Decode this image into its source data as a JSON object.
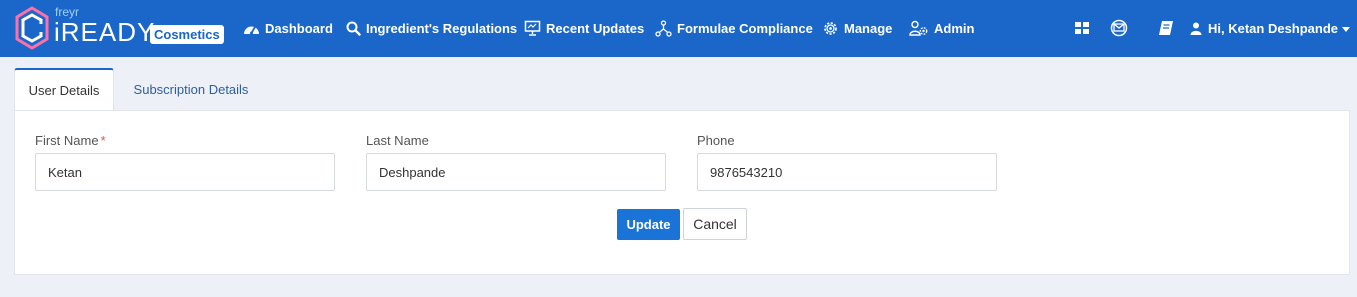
{
  "brand": {
    "freyr": "freyr",
    "name": "iREADY",
    "badge": "Cosmetics"
  },
  "nav": {
    "items": [
      {
        "label": "Dashboard",
        "icon": "dashboard-icon"
      },
      {
        "label": "Ingredient's Regulations",
        "icon": "search-icon"
      },
      {
        "label": "Recent Updates",
        "icon": "presentation-icon"
      },
      {
        "label": "Formulae Compliance",
        "icon": "network-icon"
      },
      {
        "label": "Manage",
        "icon": "gear-icon"
      },
      {
        "label": "Admin",
        "icon": "users-gear-icon"
      }
    ],
    "right_icons": [
      "grid-icon",
      "email-icon",
      "book-icon"
    ],
    "user_greeting": "Hi, Ketan Deshpande"
  },
  "tabs": [
    {
      "label": "User Details",
      "active": true
    },
    {
      "label": "Subscription Details",
      "active": false
    }
  ],
  "form": {
    "first_name": {
      "label": "First Name",
      "required_mark": "*",
      "value": "Ketan"
    },
    "last_name": {
      "label": "Last Name",
      "value": "Deshpande"
    },
    "phone": {
      "label": "Phone",
      "value": "9876543210"
    },
    "update_label": "Update",
    "cancel_label": "Cancel"
  },
  "colors": {
    "navbar": "#1a67c9",
    "primary_button": "#1a73d6",
    "required": "#d9534f"
  }
}
